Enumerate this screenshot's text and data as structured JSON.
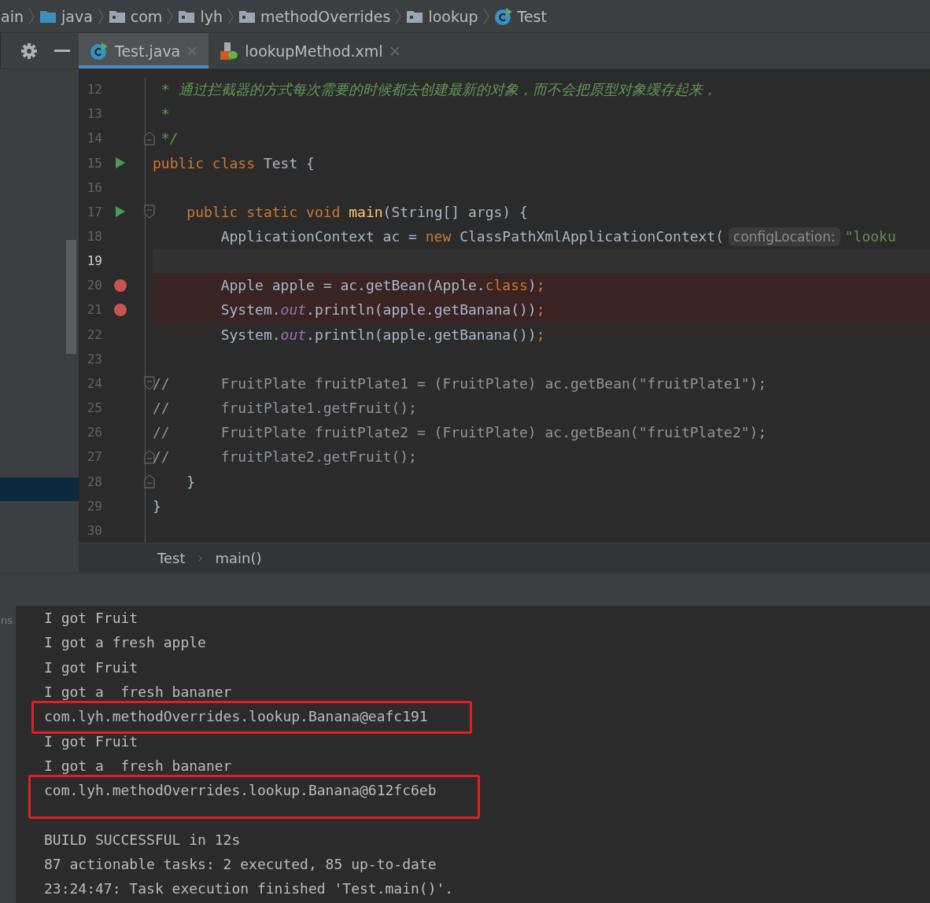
{
  "breadcrumb": [
    {
      "label": "ain",
      "kind": "text"
    },
    {
      "label": "java",
      "kind": "source_folder"
    },
    {
      "label": "com",
      "kind": "package"
    },
    {
      "label": "lyh",
      "kind": "package"
    },
    {
      "label": "methodOverrides",
      "kind": "package"
    },
    {
      "label": "lookup",
      "kind": "package"
    },
    {
      "label": "Test",
      "kind": "class"
    }
  ],
  "tabs": [
    {
      "label": "Test.java",
      "kind": "class",
      "selected": true
    },
    {
      "label": "lookupMethod.xml",
      "kind": "xml",
      "selected": false
    }
  ],
  "editor": {
    "lines": [
      {
        "number": "12",
        "runnable": false,
        "breakpoint": false,
        "current": false,
        "fold_start": false,
        "fold_end": false,
        "tokens": [
          {
            "kind": "doc",
            "text": " * 通过拦截器的方式每次需要的时候都去创建最新的对象，而不会把原型对象缓存起来，"
          }
        ]
      },
      {
        "number": "13",
        "runnable": false,
        "breakpoint": false,
        "current": false,
        "fold_start": false,
        "fold_end": false,
        "tokens": [
          {
            "kind": "doc",
            "text": " *"
          }
        ]
      },
      {
        "number": "14",
        "runnable": false,
        "breakpoint": false,
        "current": false,
        "fold_start": false,
        "fold_end": true,
        "tokens": [
          {
            "kind": "doc",
            "text": " */"
          }
        ]
      },
      {
        "number": "15",
        "runnable": true,
        "breakpoint": false,
        "current": false,
        "fold_start": false,
        "fold_end": false,
        "tokens": [
          {
            "kind": "keyword",
            "text": "public class "
          },
          {
            "kind": "plain",
            "text": "Test {"
          }
        ]
      },
      {
        "number": "16",
        "runnable": false,
        "breakpoint": false,
        "current": false,
        "fold_start": false,
        "fold_end": false
      },
      {
        "number": "17",
        "runnable": true,
        "breakpoint": false,
        "current": false,
        "fold_start": true,
        "fold_end": false,
        "tokens": [
          {
            "kind": "keyword",
            "text": "    public static void "
          },
          {
            "kind": "method",
            "text": "main"
          },
          {
            "kind": "plain",
            "text": "(String[] args) {"
          }
        ]
      },
      {
        "number": "18",
        "runnable": false,
        "breakpoint": false,
        "current": false,
        "fold_start": false,
        "fold_end": false,
        "tokens": [
          {
            "kind": "plain",
            "text": "        ApplicationContext ac = "
          },
          {
            "kind": "keyword",
            "text": "new "
          },
          {
            "kind": "plain",
            "text": "ClassPathXmlApplicationContext("
          },
          {
            "kind": "hint",
            "text": "configLocation:"
          },
          {
            "kind": "string",
            "text": "\"looku"
          }
        ]
      },
      {
        "number": "19",
        "runnable": false,
        "breakpoint": false,
        "current": true,
        "fold_start": false,
        "fold_end": false
      },
      {
        "number": "20",
        "runnable": false,
        "breakpoint": true,
        "current": false,
        "fold_start": false,
        "fold_end": false,
        "tokens": [
          {
            "kind": "plain",
            "text": "        Apple apple = ac.getBean(Apple."
          },
          {
            "kind": "keyword",
            "text": "class"
          },
          {
            "kind": "plain",
            "text": ")"
          },
          {
            "kind": "keyword",
            "text": ";"
          }
        ]
      },
      {
        "number": "21",
        "runnable": false,
        "breakpoint": true,
        "current": false,
        "fold_start": false,
        "fold_end": false,
        "tokens": [
          {
            "kind": "plain",
            "text": "        System."
          },
          {
            "kind": "field",
            "text": "out"
          },
          {
            "kind": "plain",
            "text": ".println(apple.getBanana())"
          },
          {
            "kind": "keyword",
            "text": ";"
          }
        ]
      },
      {
        "number": "22",
        "runnable": false,
        "breakpoint": false,
        "current": false,
        "fold_start": false,
        "fold_end": false,
        "tokens": [
          {
            "kind": "plain",
            "text": "        System."
          },
          {
            "kind": "field",
            "text": "out"
          },
          {
            "kind": "plain",
            "text": ".println(apple.getBanana())"
          },
          {
            "kind": "keyword",
            "text": ";"
          }
        ]
      },
      {
        "number": "23",
        "runnable": false,
        "breakpoint": false,
        "current": false,
        "fold_start": false,
        "fold_end": false
      },
      {
        "number": "24",
        "runnable": false,
        "breakpoint": false,
        "current": false,
        "fold_start": true,
        "fold_end": false,
        "tokens": [
          {
            "kind": "comment",
            "text": "//      FruitPlate fruitPlate1 = (FruitPlate) ac.getBean(\"fruitPlate1\");"
          }
        ]
      },
      {
        "number": "25",
        "runnable": false,
        "breakpoint": false,
        "current": false,
        "fold_start": false,
        "fold_end": false,
        "tokens": [
          {
            "kind": "comment",
            "text": "//      fruitPlate1.getFruit();"
          }
        ]
      },
      {
        "number": "26",
        "runnable": false,
        "breakpoint": false,
        "current": false,
        "fold_start": false,
        "fold_end": false,
        "tokens": [
          {
            "kind": "comment",
            "text": "//      FruitPlate fruitPlate2 = (FruitPlate) ac.getBean(\"fruitPlate2\");"
          }
        ]
      },
      {
        "number": "27",
        "runnable": false,
        "breakpoint": false,
        "current": false,
        "fold_start": false,
        "fold_end": true,
        "tokens": [
          {
            "kind": "comment",
            "text": "//      fruitPlate2.getFruit();"
          }
        ]
      },
      {
        "number": "28",
        "runnable": false,
        "breakpoint": false,
        "current": false,
        "fold_start": false,
        "fold_end": true,
        "tokens": [
          {
            "kind": "plain",
            "text": "    }"
          }
        ]
      },
      {
        "number": "29",
        "runnable": false,
        "breakpoint": false,
        "current": false,
        "fold_start": false,
        "fold_end": false,
        "tokens": [
          {
            "kind": "plain",
            "text": "}"
          }
        ]
      },
      {
        "number": "30",
        "runnable": false,
        "breakpoint": false,
        "current": false,
        "fold_start": false,
        "fold_end": false
      }
    ]
  },
  "code_path": [
    "Test",
    "main()"
  ],
  "console": {
    "side_label": "ns",
    "sections": [
      [
        {
          "text": "I got Fruit",
          "marked": false
        },
        {
          "text": "I got a fresh apple",
          "marked": false
        },
        {
          "text": "I got Fruit",
          "marked": false
        },
        {
          "text": "I got a  fresh bananer",
          "marked": false
        },
        {
          "text": "com.lyh.methodOverrides.lookup.Banana@eafc191",
          "marked": true
        },
        {
          "text": "I got Fruit",
          "marked": false
        },
        {
          "text": "I got a  fresh bananer",
          "marked": false
        },
        {
          "text": "com.lyh.methodOverrides.lookup.Banana@612fc6eb",
          "marked": true
        }
      ],
      [
        {
          "text": "BUILD SUCCESSFUL in 12s",
          "marked": false
        },
        {
          "text": "87 actionable tasks: 2 executed, 85 up-to-date",
          "marked": false
        },
        {
          "text": "23:24:47: Task execution finished 'Test.main()'.",
          "marked": false
        }
      ]
    ]
  }
}
